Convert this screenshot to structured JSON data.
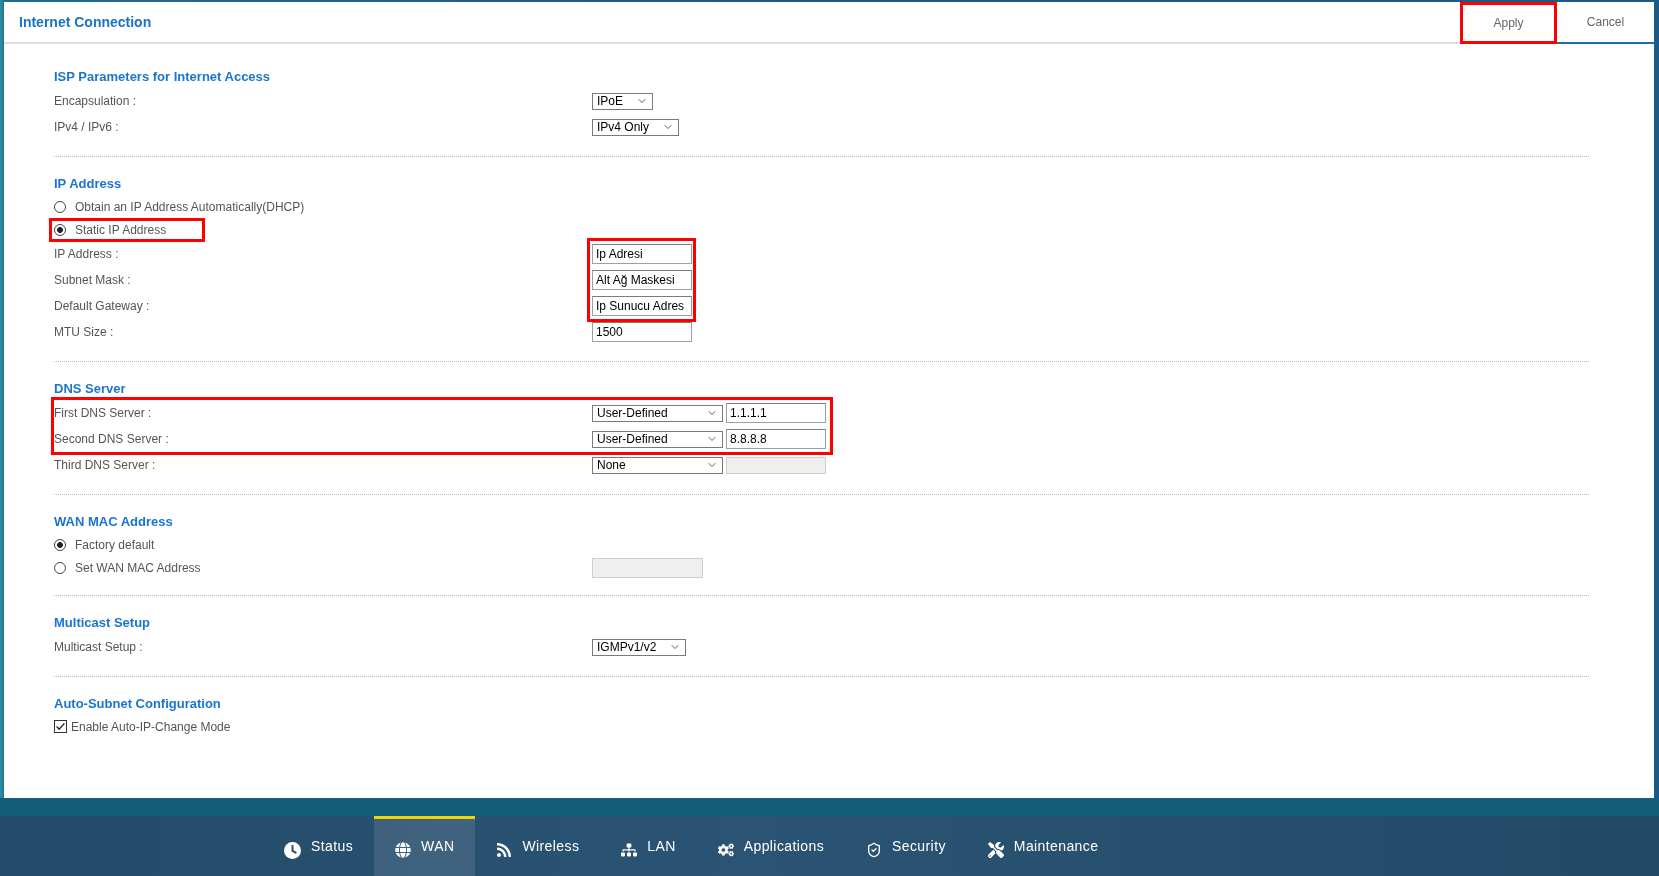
{
  "header": {
    "title": "Internet Connection",
    "buttons": [
      {
        "label": "Apply",
        "highlighted": true
      },
      {
        "label": "Cancel",
        "highlighted": false
      }
    ]
  },
  "sections": [
    {
      "title": "ISP Parameters for Internet Access",
      "items": [
        {
          "kind": "field",
          "label": "Encapsulation :",
          "highlighted": false,
          "controls": [
            {
              "kind": "select",
              "value": "IPoE",
              "highlighted": false
            }
          ]
        },
        {
          "kind": "field",
          "label": "IPv4 / IPv6 :",
          "highlighted": false,
          "controls": [
            {
              "kind": "select",
              "value": "IPv4 Only",
              "highlighted": false
            }
          ]
        }
      ]
    },
    {
      "title": "IP Address",
      "items": [
        {
          "kind": "radio",
          "label": "Obtain an IP Address Automatically(DHCP)",
          "selected": false,
          "highlighted": false
        },
        {
          "kind": "radio",
          "label": "Static IP Address",
          "selected": true,
          "highlighted": true
        },
        {
          "kind": "field",
          "label": "IP Address :",
          "highlighted": false,
          "controls": [
            {
              "kind": "input",
              "value": "Ip Adresi",
              "disabled": false,
              "highlighted": true
            }
          ]
        },
        {
          "kind": "field",
          "label": "Subnet Mask :",
          "highlighted": false,
          "controls": [
            {
              "kind": "input",
              "value": "Alt Ağ Maskesi",
              "disabled": false,
              "highlighted": true
            }
          ]
        },
        {
          "kind": "field",
          "label": "Default Gateway :",
          "highlighted": false,
          "controls": [
            {
              "kind": "input",
              "value": "Ip Sunucu Adres",
              "disabled": false,
              "highlighted": true
            }
          ]
        },
        {
          "kind": "field",
          "label": "MTU Size :",
          "highlighted": false,
          "controls": [
            {
              "kind": "input",
              "value": "1500",
              "disabled": false,
              "highlighted": false
            }
          ]
        }
      ]
    },
    {
      "title": "DNS Server",
      "items": [
        {
          "kind": "field",
          "label": "First DNS Server :",
          "highlighted": true,
          "controls": [
            {
              "kind": "select",
              "value": "User-Defined",
              "highlighted": false
            },
            {
              "kind": "input",
              "value": "1.1.1.1",
              "disabled": false,
              "highlighted": false
            }
          ]
        },
        {
          "kind": "field",
          "label": "Second DNS Server :",
          "highlighted": true,
          "controls": [
            {
              "kind": "select",
              "value": "User-Defined",
              "highlighted": false
            },
            {
              "kind": "input",
              "value": "8.8.8.8",
              "disabled": false,
              "highlighted": false
            }
          ]
        },
        {
          "kind": "field",
          "label": "Third DNS Server :",
          "highlighted": false,
          "controls": [
            {
              "kind": "select",
              "value": "None",
              "highlighted": false
            },
            {
              "kind": "input",
              "disabled": true,
              "highlighted": false
            }
          ]
        }
      ]
    },
    {
      "title": "WAN MAC Address",
      "items": [
        {
          "kind": "radio",
          "label": "Factory default",
          "selected": true,
          "highlighted": false
        },
        {
          "kind": "radio",
          "label": "Set WAN MAC Address",
          "selected": false,
          "highlighted": false,
          "controls": [
            {
              "kind": "input",
              "disabled": true,
              "highlighted": false
            }
          ]
        }
      ]
    },
    {
      "title": "Multicast Setup",
      "items": [
        {
          "kind": "field",
          "label": "Multicast Setup :",
          "highlighted": false,
          "controls": [
            {
              "kind": "select",
              "value": "IGMPv1/v2",
              "highlighted": false
            }
          ]
        }
      ]
    },
    {
      "title": "Auto-Subnet Configuration",
      "items": [
        {
          "kind": "checkbox",
          "label": "Enable Auto-IP-Change Mode",
          "checked": true,
          "highlighted": false
        }
      ]
    }
  ],
  "nav": {
    "items": [
      {
        "label": "Status",
        "selected": false
      },
      {
        "label": "WAN",
        "selected": true
      },
      {
        "label": "Wireless",
        "selected": false
      },
      {
        "label": "LAN",
        "selected": false
      },
      {
        "label": "Applications",
        "selected": false
      },
      {
        "label": "Security",
        "selected": false
      },
      {
        "label": "Maintenance",
        "selected": false
      }
    ]
  }
}
